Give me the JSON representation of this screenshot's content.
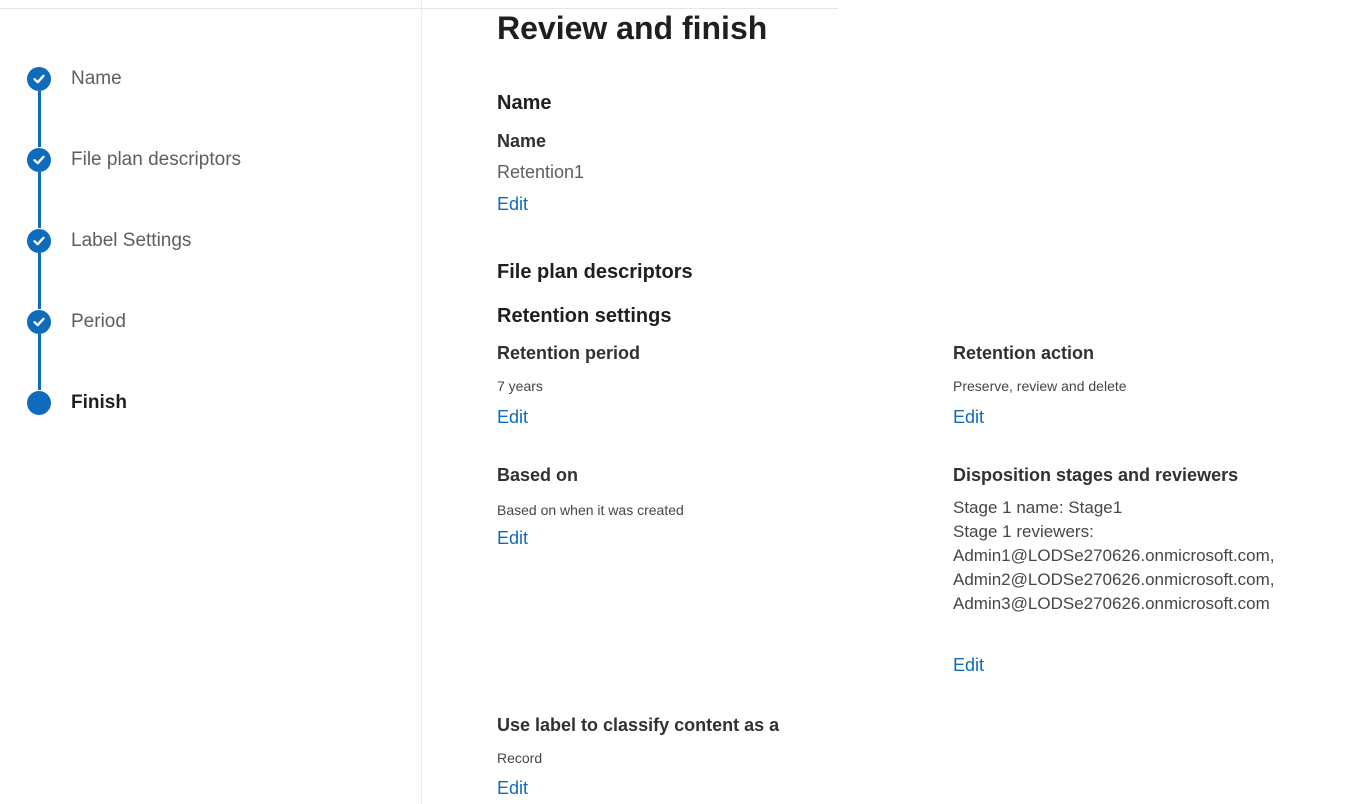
{
  "steps": [
    {
      "label": "Name",
      "state": "completed"
    },
    {
      "label": "File plan descriptors",
      "state": "completed"
    },
    {
      "label": "Label Settings",
      "state": "completed"
    },
    {
      "label": "Period",
      "state": "completed"
    },
    {
      "label": "Finish",
      "state": "current"
    }
  ],
  "page": {
    "title": "Review and finish"
  },
  "name_section": {
    "heading": "Name",
    "field_label": "Name",
    "value": "Retention1",
    "edit": "Edit"
  },
  "file_plan_section": {
    "heading": "File plan descriptors"
  },
  "retention_section": {
    "heading": "Retention settings",
    "retention_period": {
      "label": "Retention period",
      "value": "7 years",
      "edit": "Edit"
    },
    "retention_action": {
      "label": "Retention action",
      "value": "Preserve, review and delete",
      "edit": "Edit"
    },
    "based_on": {
      "label": "Based on",
      "value": "Based on when it was created",
      "edit": "Edit"
    },
    "disposition": {
      "label": "Disposition stages and reviewers",
      "stage_name": "Stage 1 name: Stage1",
      "reviewers_label": "Stage 1 reviewers:",
      "reviewers": [
        "Admin1@LODSe270626.onmicrosoft.com,",
        "Admin2@LODSe270626.onmicrosoft.com,",
        "Admin3@LODSe270626.onmicrosoft.com"
      ],
      "edit": "Edit"
    },
    "classify": {
      "label": "Use label to classify content as a",
      "value": "Record",
      "edit": "Edit"
    }
  },
  "colors": {
    "accent": "#0f6cbd",
    "text_primary": "#201f1e",
    "text_secondary": "#605e5c"
  },
  "icons": {
    "completed_step": "checkmark-icon"
  }
}
